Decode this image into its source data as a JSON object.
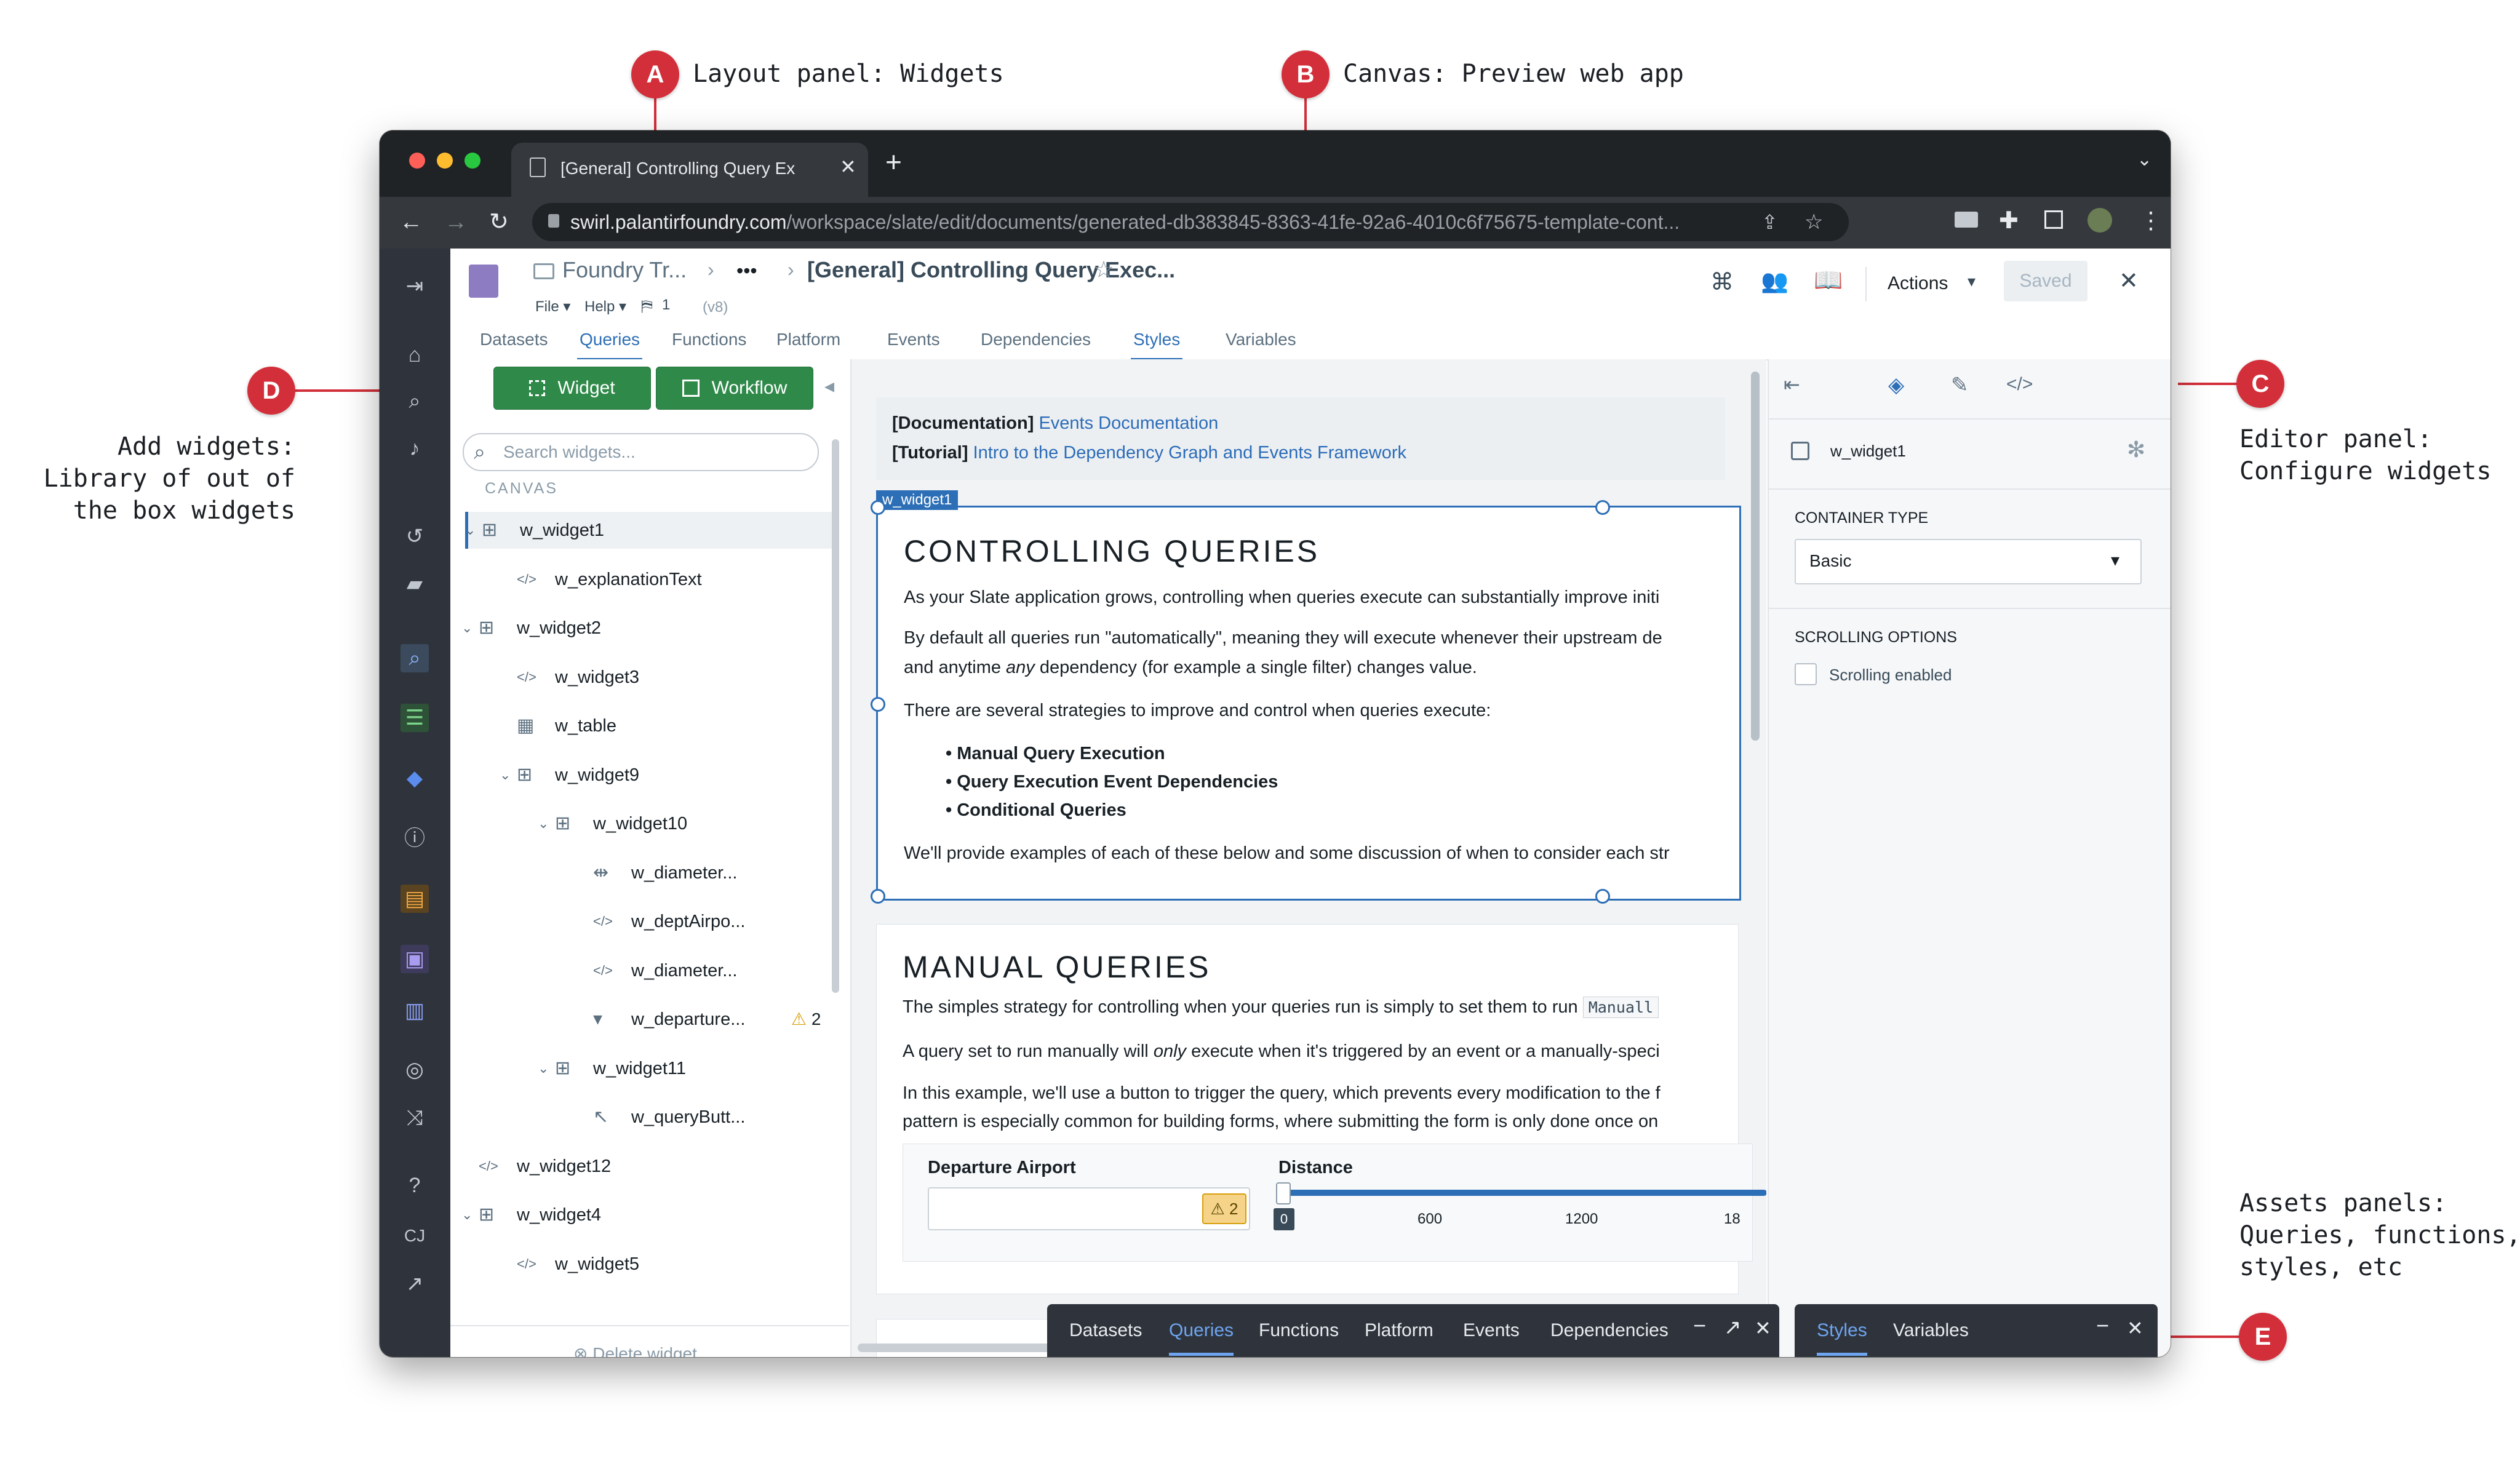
{
  "callouts": {
    "a": {
      "letter": "A",
      "text": "Layout panel: Widgets"
    },
    "b": {
      "letter": "B",
      "text": "Canvas: Preview web app"
    },
    "c": {
      "letter": "C",
      "text": "Editor panel:\nConfigure widgets"
    },
    "d": {
      "letter": "D",
      "text": "Add widgets:\nLibrary of out of\nthe box widgets"
    },
    "e": {
      "letter": "E",
      "text": "Assets panels:\nQueries, functions,\nstyles, etc"
    }
  },
  "browser": {
    "tab_title": "[General] Controlling Query Ex",
    "new_tab": "+",
    "url_host": "swirl.palantirfoundry.com",
    "url_path": "/workspace/slate/edit/documents/generated-db383845-8363-41fe-92a6-4010c6f75675-template-cont..."
  },
  "header": {
    "breadcrumb_root": "Foundry Tr...",
    "breadcrumb_more": "•••",
    "doc_title": "[General] Controlling Query Exec...",
    "menu_file": "File ▾",
    "menu_help": "Help ▾",
    "version_count": "1",
    "version_label": "(v8)",
    "actions": "Actions",
    "saved": "Saved"
  },
  "top_tabs": [
    "Datasets",
    "Queries",
    "Functions",
    "Platform",
    "Events",
    "Dependencies",
    "Styles",
    "Variables"
  ],
  "layout_panel": {
    "widget_button": "Widget",
    "workflow_button": "Workflow",
    "search_placeholder": "Search widgets...",
    "section_label": "CANVAS",
    "delete_label": "Delete widget",
    "tree": [
      {
        "label": "w_widget1",
        "icon": "container-icon",
        "depth": 0,
        "chevron": "⌄",
        "selected": true
      },
      {
        "label": "w_explanationText",
        "icon": "code-icon",
        "depth": 1
      },
      {
        "label": "w_widget2",
        "icon": "container-icon",
        "depth": 0,
        "chevron": "⌄"
      },
      {
        "label": "w_widget3",
        "icon": "code-icon",
        "depth": 1
      },
      {
        "label": "w_table",
        "icon": "table-icon",
        "depth": 1
      },
      {
        "label": "w_widget9",
        "icon": "container-icon",
        "depth": 1,
        "chevron": "⌄"
      },
      {
        "label": "w_widget10",
        "icon": "container-icon",
        "depth": 2,
        "chevron": "⌄"
      },
      {
        "label": "w_diameter...",
        "icon": "slider-icon",
        "depth": 3
      },
      {
        "label": "w_deptAirpo...",
        "icon": "code-icon",
        "depth": 3
      },
      {
        "label": "w_diameter...",
        "icon": "code-icon",
        "depth": 3
      },
      {
        "label": "w_departure...",
        "icon": "dropdown-icon",
        "depth": 3,
        "warning": "2"
      },
      {
        "label": "w_widget11",
        "icon": "container-icon",
        "depth": 2,
        "chevron": "⌄"
      },
      {
        "label": "w_queryButt...",
        "icon": "cursor-icon",
        "depth": 3
      },
      {
        "label": "w_widget12",
        "icon": "code-icon",
        "depth": 0
      },
      {
        "label": "w_widget4",
        "icon": "container-icon",
        "depth": 0,
        "chevron": "⌄"
      },
      {
        "label": "w_widget5",
        "icon": "code-icon",
        "depth": 1
      }
    ]
  },
  "canvas": {
    "doc_line1_prefix": "[Documentation]",
    "doc_line1_link": "Events Documentation",
    "doc_line2_prefix": "[Tutorial]",
    "doc_line2_link": "Intro to the Dependency Graph and Events Framework",
    "selected_widget_tag": "w_widget1",
    "section1_title": "CONTROLLING QUERIES",
    "section1_p1": "As your Slate application grows, controlling when queries execute can substantially improve initi",
    "section1_p2a": "By default all queries run \"automatically\", meaning they will execute whenever their upstream de",
    "section1_p2b_pre": "and anytime ",
    "section1_p2b_em": "any",
    "section1_p2b_post": " dependency (for example a single filter) changes value.",
    "section1_p3": "There are several strategies to improve and control when queries execute:",
    "section1_bullets": [
      "Manual Query Execution",
      "Query Execution Event Dependencies",
      "Conditional Queries"
    ],
    "section1_p4": "We'll provide examples of each of these below and some discussion of when to consider each str",
    "section2_title": "MANUAL QUERIES",
    "section2_p1": "The simples strategy for controlling when your queries run is simply to set them to run",
    "section2_code": "Manuall",
    "section2_p2_pre": "A query set to run manually will ",
    "section2_p2_em": "only",
    "section2_p2_post": " execute when it's triggered by an event or a manually-speci",
    "section2_p3a": "In this example, we'll use a button to trigger the query, which prevents every modification to the f",
    "section2_p3b": "pattern is especially common for building forms, where submitting the form is only done once on",
    "departure_label": "Departure Airport",
    "departure_warning": "2",
    "distance_label": "Distance",
    "slider_value": "0",
    "slider_ticks": [
      "600",
      "1200",
      "18"
    ]
  },
  "editor": {
    "widget_name": "w_widget1",
    "container_type_label": "CONTAINER TYPE",
    "container_type_value": "Basic",
    "scrolling_label": "SCROLLING OPTIONS",
    "scrolling_checkbox": "Scrolling enabled"
  },
  "dock_left": {
    "tabs": [
      "Datasets",
      "Queries",
      "Functions",
      "Platform",
      "Events",
      "Dependencies"
    ],
    "active": "Queries"
  },
  "dock_right": {
    "tabs": [
      "Styles",
      "Variables"
    ],
    "active": "Styles"
  },
  "colors": {
    "callout": "#d32f3a",
    "accent": "#2d6fb6",
    "green": "#2f8a4a",
    "rail": "#2f343c"
  }
}
